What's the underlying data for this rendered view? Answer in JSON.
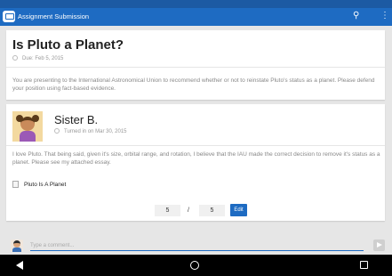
{
  "app": {
    "title": "Assignment Submission"
  },
  "assignment": {
    "title": "Is Pluto a Planet?",
    "due": "Due: Feb 5, 2015",
    "description": "You are presenting to the International Astronomical Union to recommend whether or not to reinstate Pluto's status as a planet.  Please defend your position using fact-based evidence."
  },
  "submission": {
    "student_name": "Sister B.",
    "turned_in": "Turned in on Mar 30, 2015",
    "text": "I love Pluto.  That being said, given it's size, orbital range, and rotation, I believe that the IAU made the correct decision to remove it's status as a planet.  Please see my attached essay.",
    "attachment": "Pluto Is A Planet",
    "grade": {
      "score": "5",
      "separator": "/",
      "max": "5"
    },
    "edit_label": "Edit"
  },
  "comment": {
    "placeholder": "Type a comment..."
  },
  "colors": {
    "accent": "#1e6bc2",
    "status_bar": "#1c5aa3"
  },
  "icons": [
    "app-logo-icon",
    "search-icon",
    "more-vert-icon",
    "clock-icon",
    "document-icon",
    "send-icon",
    "back-icon",
    "home-icon",
    "recents-icon"
  ]
}
